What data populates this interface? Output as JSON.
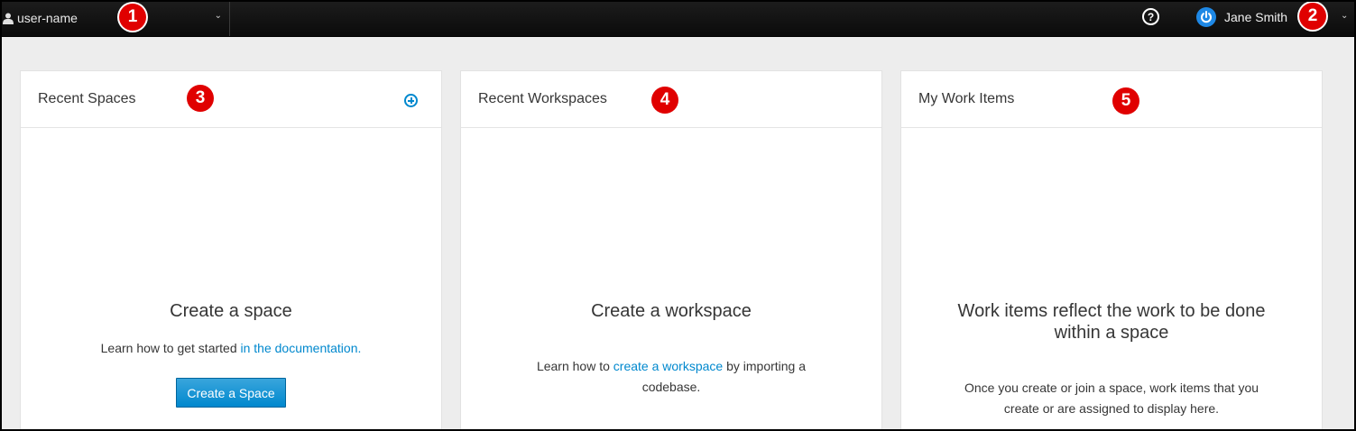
{
  "topbar": {
    "user_context": "user-name",
    "help_glyph": "?",
    "profile_name": "Jane Smith"
  },
  "callouts": [
    "1",
    "2",
    "3",
    "4",
    "5"
  ],
  "cards": {
    "recent_spaces": {
      "title": "Recent Spaces",
      "empty_title": "Create a space",
      "text_before": "Learn how to get started ",
      "link": "in the documentation.",
      "button": "Create a Space"
    },
    "recent_workspaces": {
      "title": "Recent Workspaces",
      "empty_title": "Create a workspace",
      "text_before": "Learn how to ",
      "link": "create a workspace",
      "text_after_line1": " by importing a",
      "text_line2": "codebase."
    },
    "my_work_items": {
      "title": "My Work Items",
      "empty_title_line1": "Work items reflect the work to be done",
      "empty_title_line2": "within a space",
      "text_line1": "Once you create or join a space, work items that you",
      "text_line2": "create or are assigned to display here."
    }
  },
  "colors": {
    "accent": "#0088ce",
    "callout": "#e00000",
    "topbar": "#111111",
    "page_bg": "#ededed"
  }
}
